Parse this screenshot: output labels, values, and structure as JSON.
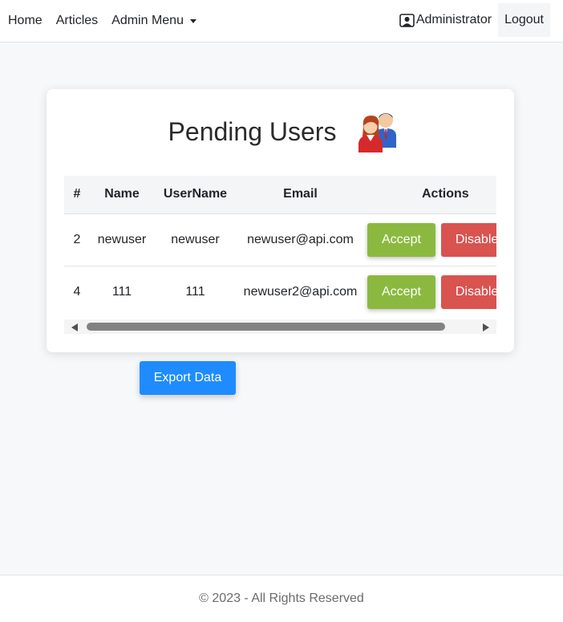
{
  "nav": {
    "home": "Home",
    "articles": "Articles",
    "admin_menu": "Admin Menu",
    "user": "Administrator",
    "logout": "Logout"
  },
  "card": {
    "title": "Pending Users",
    "icon": "users-icon"
  },
  "table": {
    "headers": {
      "num": "#",
      "name": "Name",
      "username": "UserName",
      "email": "Email",
      "actions": "Actions"
    },
    "rows": [
      {
        "id": "2",
        "name": "newuser",
        "username": "newuser",
        "email": "newuser@api.com",
        "accept": "Accept",
        "disable": "Disable"
      },
      {
        "id": "4",
        "name": "111",
        "username": "111",
        "email": "newuser2@api.com",
        "accept": "Accept",
        "disable": "Disable"
      }
    ]
  },
  "export_button": "Export Data",
  "footer": "© 2023 - All Rights Reserved",
  "colors": {
    "accept": "#8bb93f",
    "disable": "#d9534f",
    "primary": "#1e8cff"
  }
}
